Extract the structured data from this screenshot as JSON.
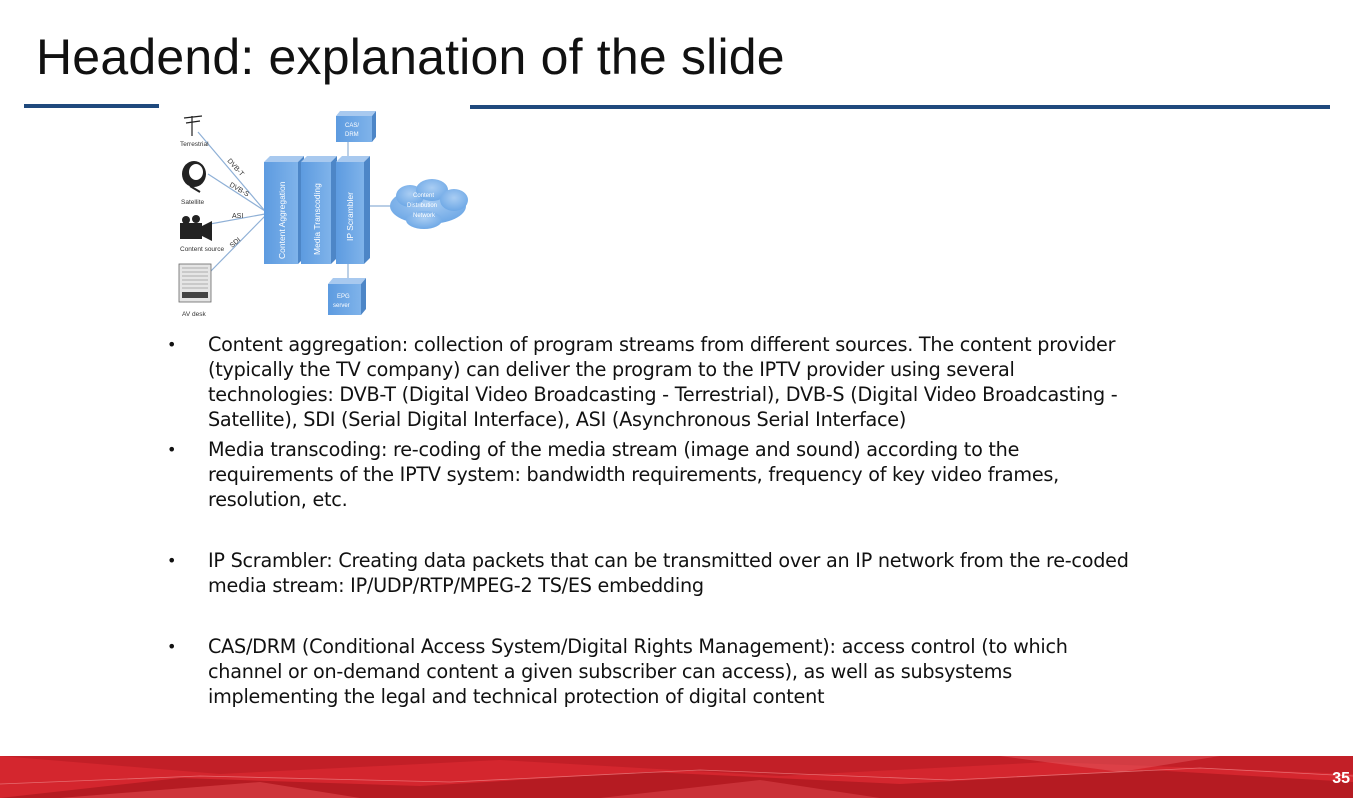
{
  "slide": {
    "title": "Headend: explanation of the slide",
    "page_number": "35"
  },
  "diagram": {
    "sources": [
      "Terrestrial",
      "Satellite",
      "Content source",
      "AV desk"
    ],
    "links": [
      "DVB-T",
      "DVB-S",
      "ASI",
      "SDI"
    ],
    "blocks": [
      "Content Aggregation",
      "Media Transcoding",
      "IP Scrambler"
    ],
    "cas_drm": [
      "CAS/",
      "DRM"
    ],
    "epg": [
      "EPG",
      "server"
    ],
    "cdn": [
      "Content",
      "Distribution",
      "Network"
    ]
  },
  "bullets": [
    {
      "lines": [
        "Content aggregation: collection of program streams from different sources. The content provider",
        "(typically the TV company) can deliver the program to the IPTV provider using several",
        "technologies: DVB-T (Digital Video Broadcasting - Terrestrial), DVB-S (Digital Video Broadcasting -",
        "Satellite), SDI (Serial Digital Interface), ASI (Asynchronous Serial Interface)"
      ]
    },
    {
      "lines": [
        "Media transcoding: re-coding of the media stream (image and sound) according to the",
        "requirements of the IPTV system: bandwidth requirements, frequency of key video frames,",
        "resolution, etc."
      ]
    },
    {
      "lines": [
        "IP Scrambler: Creating data packets that can be transmitted over an IP network from the re-coded",
        "media stream: IP/UDP/RTP/MPEG-2 TS/ES embedding"
      ]
    },
    {
      "lines": [
        "CAS/DRM (Conditional Access System/Digital Rights Management): access control (to which",
        "channel or on-demand content a given subscriber can access), as well as subsystems",
        "implementing the legal and technical protection of digital content"
      ]
    }
  ],
  "bullet_symbol": "•",
  "colors": {
    "rule": "#1f497d",
    "block_fill": "#6fa8e6",
    "footer_red": "#d4262e"
  }
}
